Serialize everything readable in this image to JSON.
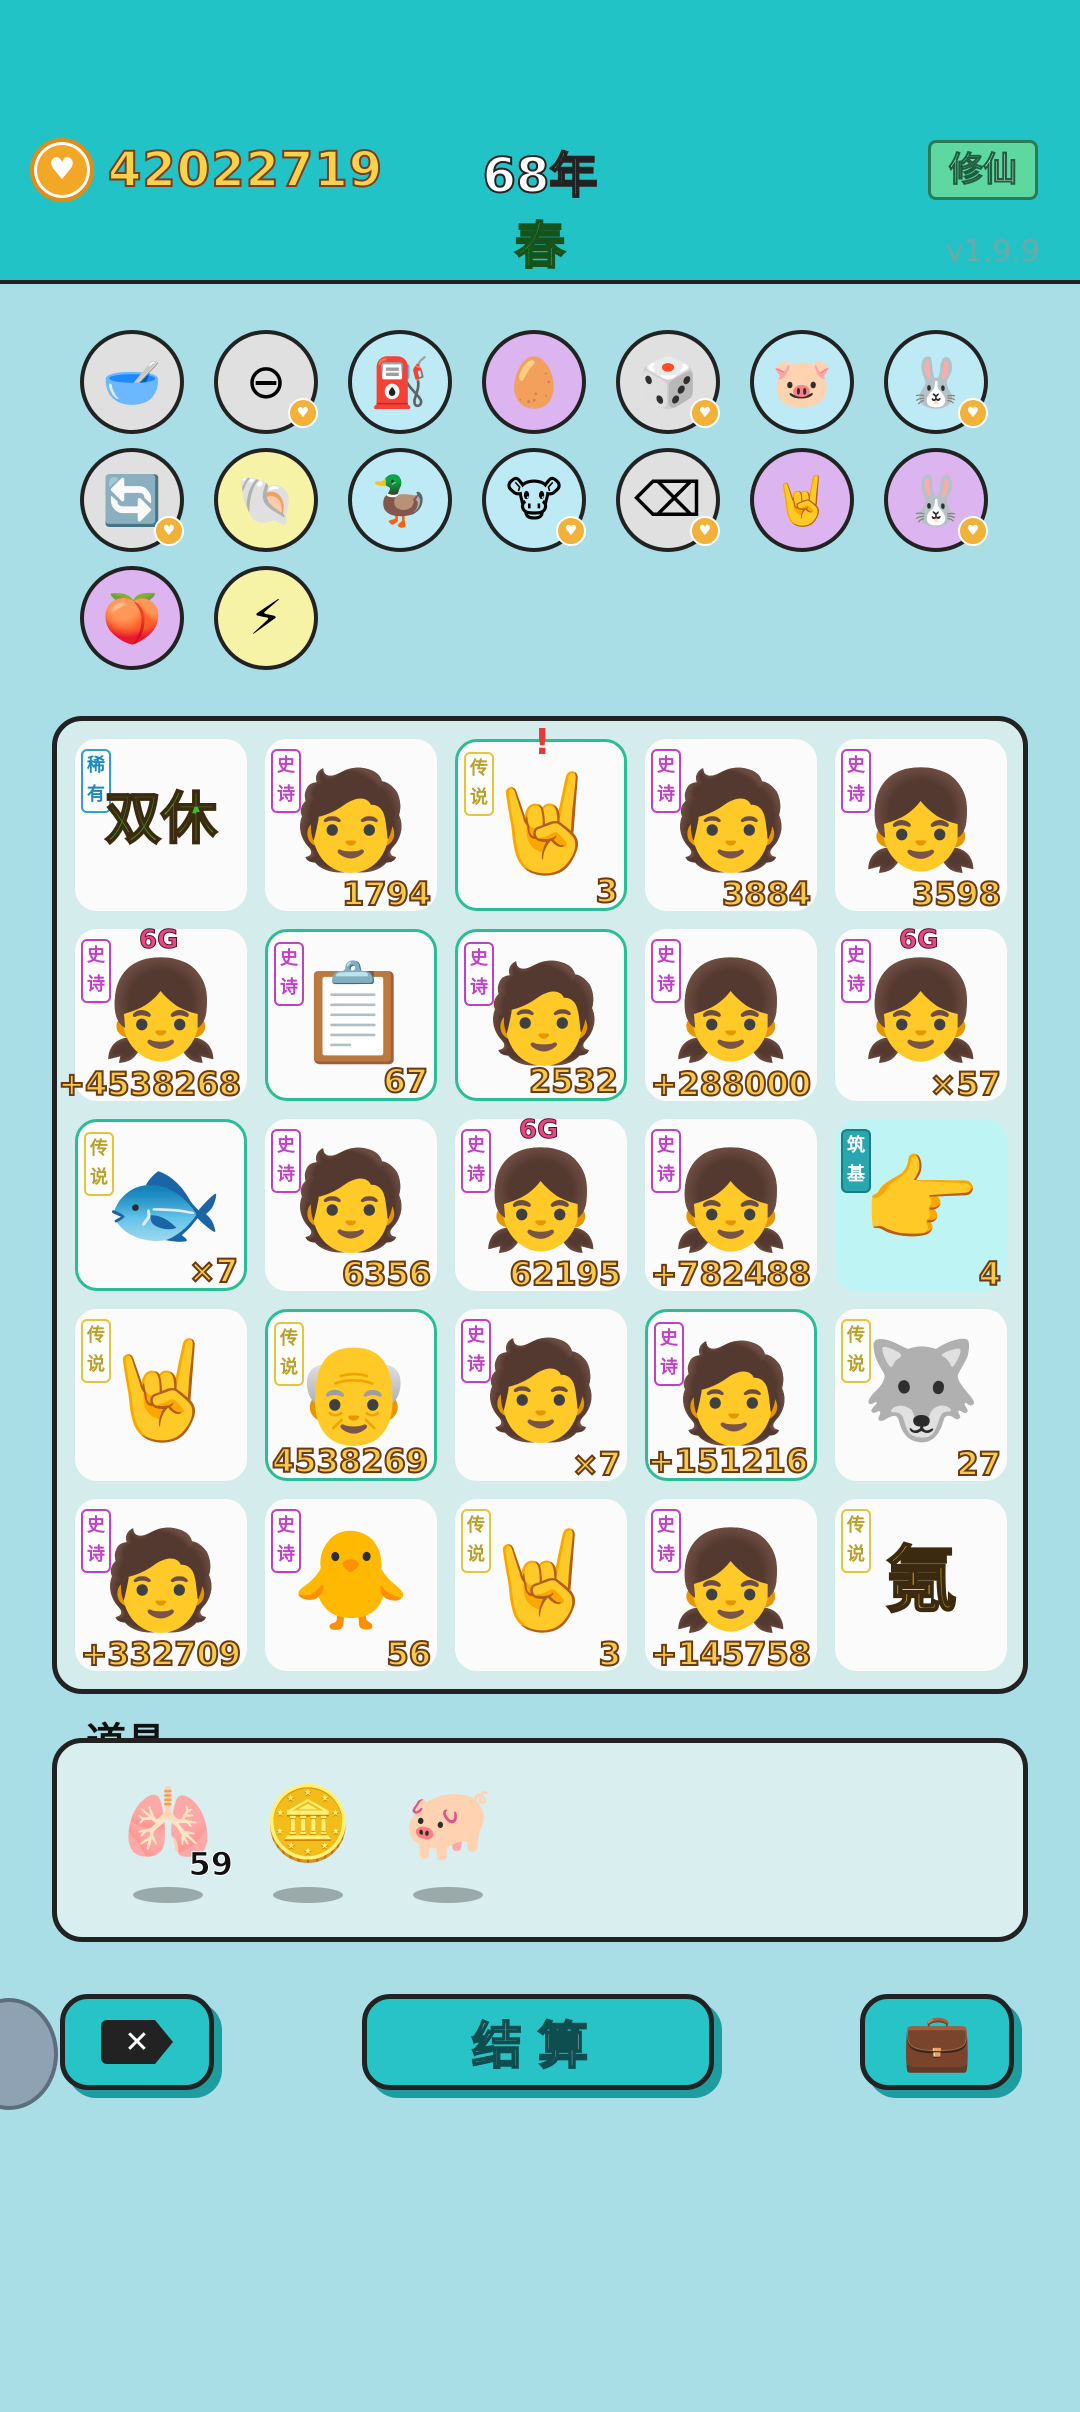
{
  "header": {
    "coins": "42022719",
    "year": "68年",
    "season": "春",
    "mode_button": "修仙",
    "version": "v1.9.9"
  },
  "skills": [
    {
      "icon": "dog-food-bowl-icon",
      "glyph": "🥣",
      "color": "#dfe0df"
    },
    {
      "icon": "minus-circle-icon",
      "glyph": "⊖",
      "color": "#dfe0df",
      "badge": true
    },
    {
      "icon": "tire-pump-icon",
      "glyph": "⛽",
      "color": "#bdeaf5"
    },
    {
      "icon": "cracked-egg-icon",
      "glyph": "🥚",
      "color": "#dcb4ef"
    },
    {
      "icon": "dice-icon",
      "glyph": "🎲",
      "color": "#dfe0df",
      "badge": true
    },
    {
      "icon": "piggy-bank-icon",
      "glyph": "🐷",
      "color": "#bdeaf5"
    },
    {
      "icon": "rabbit-icon",
      "glyph": "🐰",
      "color": "#bdeaf5",
      "badge": true
    },
    {
      "icon": "refresh-icon",
      "glyph": "🔄",
      "color": "#dfe0df",
      "badge": true
    },
    {
      "icon": "shell-icon",
      "glyph": "🐚",
      "color": "#f6f3a7"
    },
    {
      "icon": "duck-pot-icon",
      "glyph": "🦆",
      "color": "#bdeaf5"
    },
    {
      "icon": "cow-duo-icon",
      "glyph": "🐮",
      "color": "#bdeaf5",
      "badge": true
    },
    {
      "icon": "delete-key-icon",
      "glyph": "⌫",
      "color": "#dfe0df",
      "badge": true
    },
    {
      "icon": "rock-hand-icon",
      "glyph": "🤘",
      "color": "#dcb4ef"
    },
    {
      "icon": "rabbit-icon",
      "glyph": "🐰",
      "color": "#dcb4ef",
      "badge": true
    },
    {
      "icon": "pirate-peach-icon",
      "glyph": "🍑",
      "color": "#dcb4ef"
    },
    {
      "icon": "lightning-icon",
      "glyph": "⚡",
      "color": "#f6f3a7"
    }
  ],
  "tags": {
    "epic": "史诗",
    "legend": "传说",
    "rare": "稀有",
    "base": "筑基"
  },
  "board": [
    {
      "tag": "rare",
      "char": "双休",
      "text": true,
      "num": ""
    },
    {
      "tag": "epic",
      "char": "🧑",
      "num": "1794"
    },
    {
      "tag": "legend",
      "char": "🤘",
      "num": "3",
      "hl": true,
      "excl": "!"
    },
    {
      "tag": "epic",
      "char": "🧑",
      "num": "3884"
    },
    {
      "tag": "epic",
      "char": "👧",
      "num": "3598"
    },
    {
      "tag": "epic",
      "char": "👧",
      "num": "+4538268",
      "sixg": "6G"
    },
    {
      "tag": "epic",
      "char": "📋",
      "num": "67",
      "hl": true
    },
    {
      "tag": "epic",
      "char": "🧑",
      "num": "2532",
      "hl": true
    },
    {
      "tag": "epic",
      "char": "👧",
      "num": "+288000"
    },
    {
      "tag": "epic",
      "char": "👧",
      "num": "×57",
      "sixg": "6G"
    },
    {
      "tag": "legend",
      "char": "🐟",
      "num": "×7",
      "hl": true
    },
    {
      "tag": "epic",
      "char": "🧑",
      "num": "6356"
    },
    {
      "tag": "epic",
      "char": "👧",
      "num": "62195",
      "sixg": "6G"
    },
    {
      "tag": "epic",
      "char": "👧",
      "num": "+782488"
    },
    {
      "tag": "base",
      "char": "👉",
      "num": "4",
      "cyan": true
    },
    {
      "tag": "legend",
      "char": "🤘",
      "num": ""
    },
    {
      "tag": "legend",
      "char": "👴",
      "num": "4538269",
      "hl": true
    },
    {
      "tag": "epic",
      "char": "🧑",
      "num": "×7"
    },
    {
      "tag": "epic",
      "char": "🧑",
      "num": "+151216",
      "hl": true
    },
    {
      "tag": "legend",
      "char": "🐺",
      "num": "27"
    },
    {
      "tag": "epic",
      "char": "🧑",
      "num": "+332709"
    },
    {
      "tag": "epic",
      "char": "🐥",
      "num": "56"
    },
    {
      "tag": "legend",
      "char": "🤘",
      "num": "3"
    },
    {
      "tag": "epic",
      "char": "👧",
      "num": "+145758"
    },
    {
      "tag": "legend",
      "char": "氪",
      "text": true,
      "num": ""
    }
  ],
  "items": {
    "title": "道具",
    "list": [
      {
        "icon": "liver-icon",
        "glyph": "🫁",
        "count": "59"
      },
      {
        "icon": "dollar-coin-icon",
        "glyph": "🪙",
        "count": ""
      },
      {
        "icon": "pink-pig-icon",
        "glyph": "🐖",
        "count": ""
      }
    ]
  },
  "buttons": {
    "settle": "结算"
  },
  "colors": {
    "header": "#22c3c6",
    "bg": "#a9dee6",
    "accent": "#27c3c7"
  }
}
